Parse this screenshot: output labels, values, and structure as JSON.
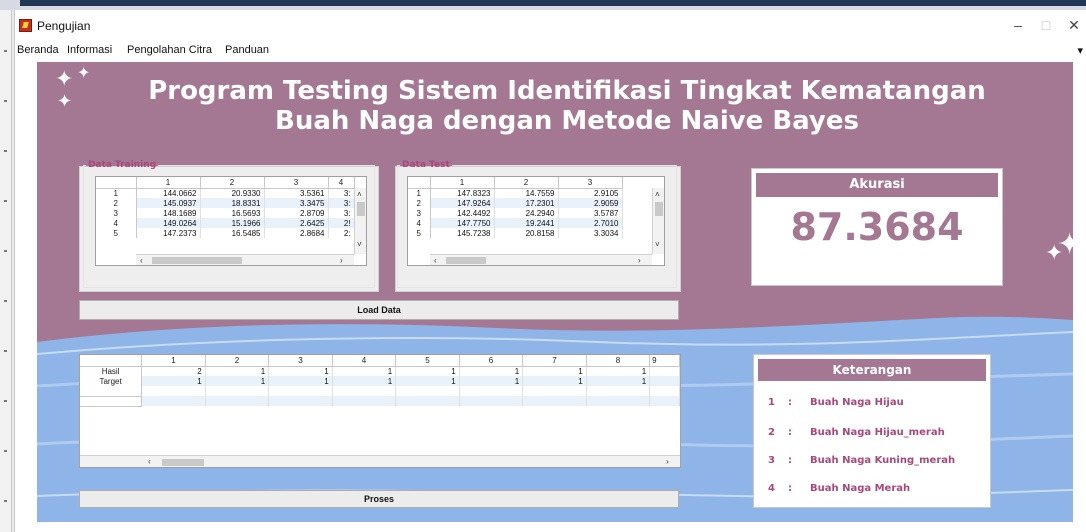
{
  "window": {
    "title": "Pengujian"
  },
  "menu": [
    "Beranda",
    "Informasi",
    "Pengolahan Citra",
    "Panduan"
  ],
  "heading": {
    "line1": "Program Testing Sistem Identifikasi Tingkat Kematangan",
    "line2": "Buah Naga dengan Metode Naive Bayes"
  },
  "training": {
    "legend": "Data Training",
    "columns": [
      "",
      "1",
      "2",
      "3",
      "4"
    ],
    "rows": [
      [
        "1",
        "144.0662",
        "20.9330",
        "3.5361",
        "3:"
      ],
      [
        "2",
        "145.0937",
        "18.8331",
        "3.3475",
        "3:"
      ],
      [
        "3",
        "148.1689",
        "16.5693",
        "2.8709",
        "3:"
      ],
      [
        "4",
        "149.0264",
        "15.1966",
        "2.6425",
        "2!"
      ],
      [
        "5",
        "147.2373",
        "16.5485",
        "2.8684",
        "2:"
      ]
    ]
  },
  "test": {
    "legend": "Data Test",
    "columns": [
      "",
      "1",
      "2",
      "3"
    ],
    "rows": [
      [
        "1",
        "147.8323",
        "14.7559",
        "2.9105"
      ],
      [
        "2",
        "147.9264",
        "17.2301",
        "2.9059"
      ],
      [
        "3",
        "142.4492",
        "24.2940",
        "3.5787"
      ],
      [
        "4",
        "147.7750",
        "19.2441",
        "2.7010"
      ],
      [
        "5",
        "145.7238",
        "20.8158",
        "3.3034"
      ]
    ]
  },
  "load_button": "Load Data",
  "akurasi": {
    "title": "Akurasi",
    "value": "87.3684"
  },
  "results": {
    "columns": [
      "",
      "1",
      "2",
      "3",
      "4",
      "5",
      "6",
      "7",
      "8",
      "9"
    ],
    "rows": [
      [
        "Hasil",
        "2",
        "1",
        "1",
        "1",
        "1",
        "1",
        "1",
        "1",
        ""
      ],
      [
        "Target",
        "1",
        "1",
        "1",
        "1",
        "1",
        "1",
        "1",
        "1",
        ""
      ],
      [
        "",
        "",
        "",
        "",
        "",
        "",
        "",
        "",
        "",
        ""
      ],
      [
        "",
        "",
        "",
        "",
        "",
        "",
        "",
        "",
        "",
        ""
      ]
    ]
  },
  "proses_button": "Proses",
  "keterangan": {
    "title": "Keterangan",
    "separator": ":",
    "items": [
      {
        "num": "1",
        "label": "Buah Naga Hijau"
      },
      {
        "num": "2",
        "label": "Buah Naga Hijau_merah"
      },
      {
        "num": "3",
        "label": "Buah Naga Kuning_merah"
      },
      {
        "num": "4",
        "label": "Buah Naga Merah"
      }
    ]
  },
  "colors": {
    "panel": "#a47792",
    "wave": "#8eb4e8",
    "accent_text": "#a8487b"
  }
}
